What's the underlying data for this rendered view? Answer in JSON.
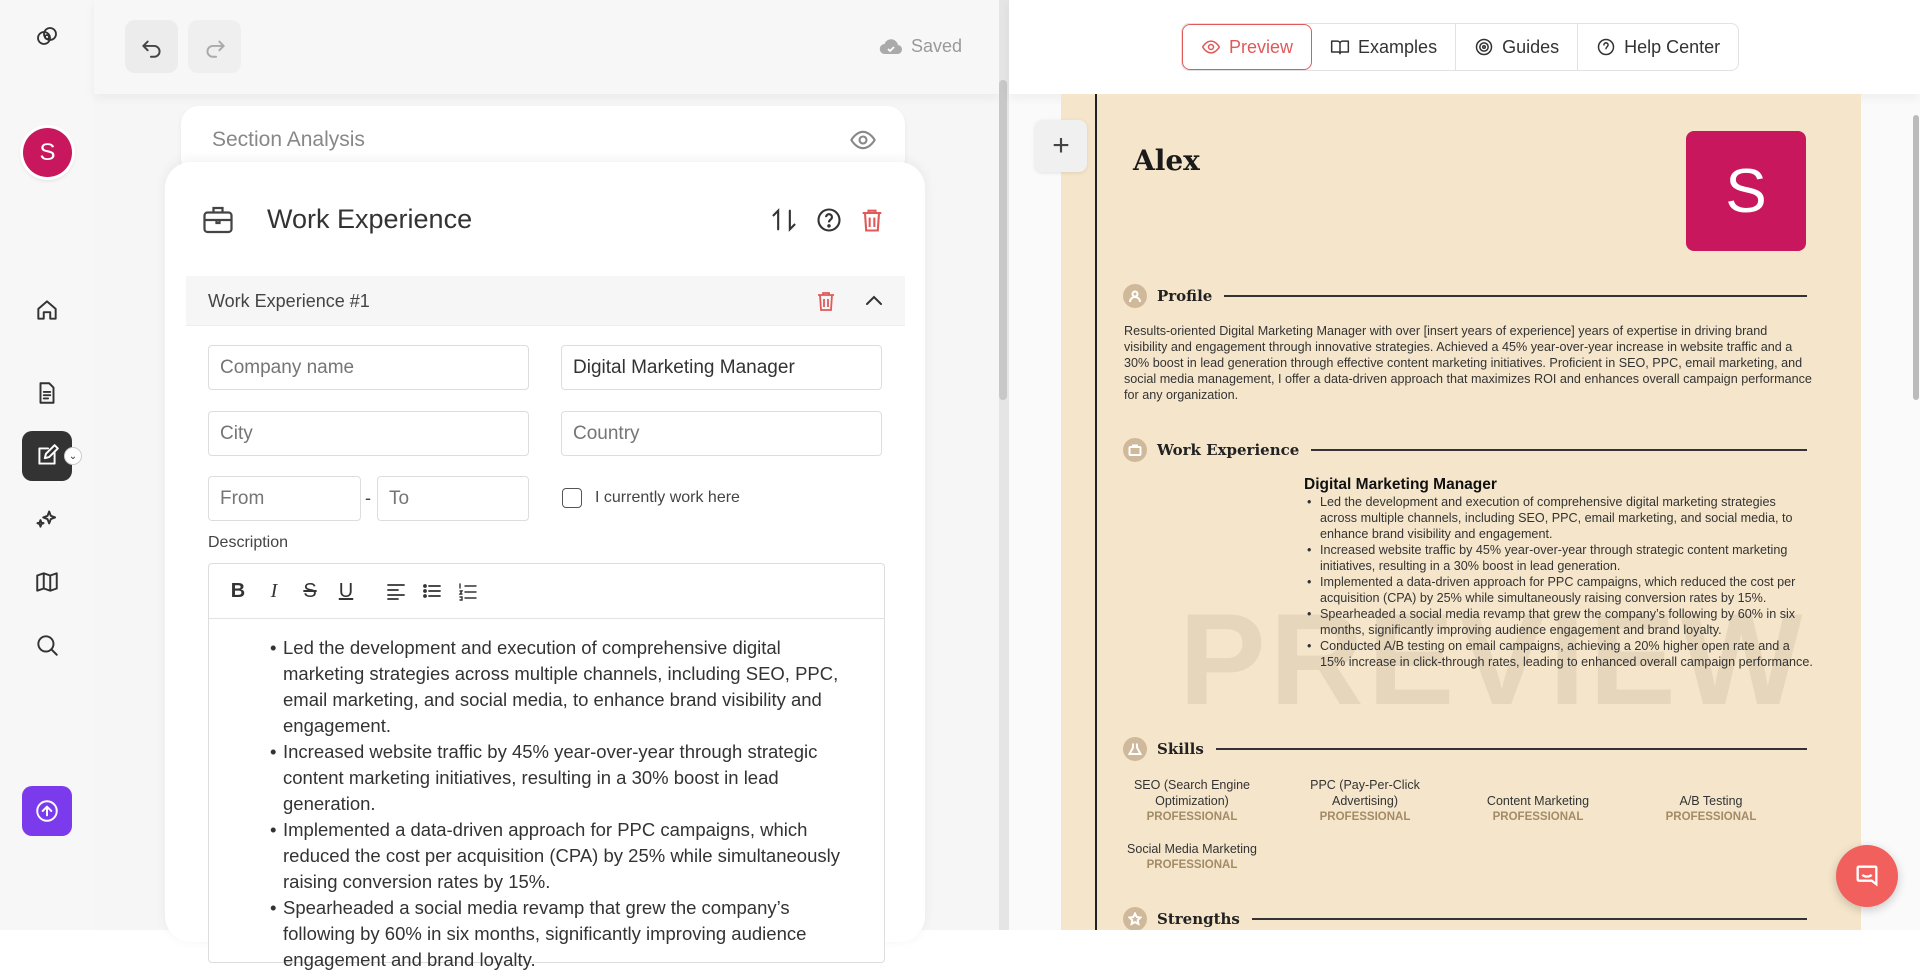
{
  "sidebar": {
    "avatar_letter": "S",
    "icons": [
      "logo-icon",
      "home-icon",
      "document-icon",
      "edit-icon",
      "sparkle-icon",
      "map-icon",
      "search-icon",
      "upload-icon"
    ]
  },
  "toolbar": {
    "saved_label": "Saved"
  },
  "section_analysis": {
    "label": "Section Analysis"
  },
  "work_section": {
    "title": "Work Experience",
    "entry_label": "Work Experience #1",
    "company_placeholder": "Company name",
    "job_title_value": "Digital Marketing Manager",
    "city_placeholder": "City",
    "country_placeholder": "Country",
    "from_placeholder": "From",
    "to_placeholder": "To",
    "date_separator": "-",
    "current_label": "I currently work here",
    "description_label": "Description",
    "description_items": [
      "Led the development and execution of comprehensive digital marketing strategies across multiple channels, including SEO, PPC, email marketing, and social media, to enhance brand visibility and engagement.",
      "Increased website traffic by 45% year-over-year through strategic content marketing initiatives, resulting in a 30% boost in lead generation.",
      "Implemented a data-driven approach for PPC campaigns, which reduced the cost per acquisition (CPA) by 25% while simultaneously raising conversion rates by 15%.",
      "Spearheaded a social media revamp that grew the company’s following by 60% in six months, significantly improving audience engagement and brand loyalty."
    ]
  },
  "preview_nav": {
    "preview": "Preview",
    "examples": "Examples",
    "guides": "Guides",
    "help": "Help Center"
  },
  "resume": {
    "name": "Alex",
    "photo_letter": "S",
    "watermark": "PREVIEW",
    "profile_heading": "Profile",
    "profile_text": "Results-oriented Digital Marketing Manager with over [insert years of experience] years of expertise in driving brand visibility and engagement through innovative strategies. Achieved a 45% year-over-year increase in website traffic and a 30% boost in lead generation through effective content marketing initiatives. Proficient in SEO, PPC, email marketing, and social media management, I offer a data-driven approach that maximizes ROI and enhances overall campaign performance for any organization.",
    "work_heading": "Work Experience",
    "job_title": "Digital Marketing Manager",
    "job_items": [
      "Led the development and execution of comprehensive digital marketing strategies across multiple channels, including SEO, PPC, email marketing, and social media, to enhance brand visibility and engagement.",
      "Increased website traffic by 45% year-over-year through strategic content marketing initiatives, resulting in a 30% boost in lead generation.",
      "Implemented a data-driven approach for PPC campaigns, which reduced the cost per acquisition (CPA) by 25% while simultaneously raising conversion rates by 15%.",
      "Spearheaded a social media revamp that grew the company’s following by 60% in six months, significantly improving audience engagement and brand loyalty.",
      "Conducted A/B testing on email campaigns, achieving a 20% higher open rate and a 15% increase in click-through rates, leading to enhanced overall campaign performance."
    ],
    "skills_heading": "Skills",
    "skills": [
      {
        "name": "SEO (Search Engine Optimization)",
        "level": "PROFESSIONAL"
      },
      {
        "name": "PPC (Pay-Per-Click Advertising)",
        "level": "PROFESSIONAL"
      },
      {
        "name": "Content Marketing",
        "level": "PROFESSIONAL"
      },
      {
        "name": "A/B Testing",
        "level": "PROFESSIONAL"
      },
      {
        "name": "Social Media Marketing",
        "level": "PROFESSIONAL"
      }
    ],
    "strengths_heading": "Strengths"
  },
  "colors": {
    "accent": "#c8175d",
    "preview_accent": "#e05a5a",
    "resume_bg": "#f5e6cb",
    "upload_btn": "#7c3aed",
    "chat": "#f1605c"
  }
}
